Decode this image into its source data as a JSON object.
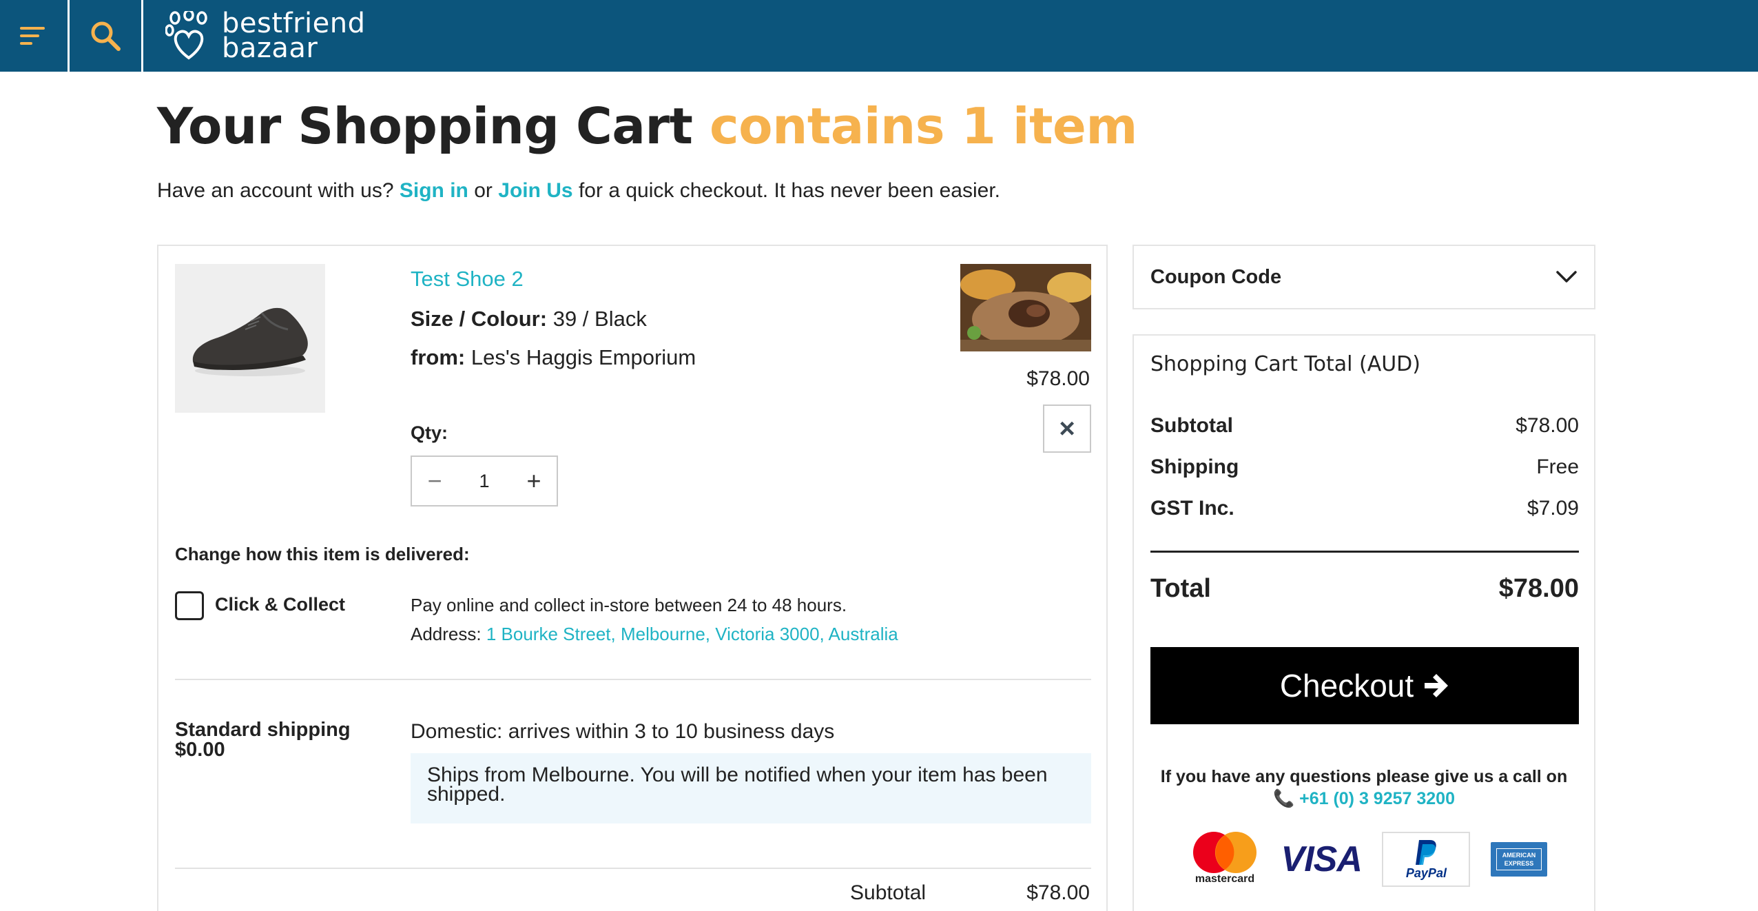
{
  "header": {
    "logo_line1": "bestfriend",
    "logo_line2": "bazaar",
    "colors": {
      "bar": "#0c557c",
      "icon": "#f6b24e"
    }
  },
  "page": {
    "title_main": "Your Shopping Cart",
    "title_count": "contains 1 item",
    "intro_before": "Have an account with us?",
    "sign_in": "Sign in",
    "intro_or": "or",
    "join_us": "Join Us",
    "intro_after": "for a quick checkout. It has never been easier."
  },
  "cart_item": {
    "name": "Test Shoe 2",
    "size_colour_label": "Size / Colour:",
    "size_colour_value": "39 / Black",
    "from_label": "from:",
    "from_value": "Les's Haggis Emporium",
    "price": "$78.00",
    "remove_icon": "×",
    "qty_label": "Qty:",
    "qty_minus": "−",
    "qty_value": "1",
    "qty_plus": "+"
  },
  "delivery": {
    "heading": "Change how this item is delivered:",
    "click_collect_label": "Click & Collect",
    "click_collect_desc": "Pay online and collect in-store between 24 to 48 hours.",
    "address_label": "Address:",
    "address_value": "1 Bourke Street, Melbourne, Victoria 3000, Australia",
    "standard_title": "Standard shipping",
    "standard_price": "$0.00",
    "standard_desc": "Domestic: arrives within 3 to 10 business days",
    "standard_note": "Ships from Melbourne. You will be notified when your item has been shipped.",
    "subtotal_label": "Subtotal",
    "subtotal_value": "$78.00"
  },
  "coupon": {
    "label": "Coupon Code"
  },
  "totals": {
    "title": "Shopping Cart Total (AUD)",
    "rows": [
      {
        "label": "Subtotal",
        "value": "$78.00"
      },
      {
        "label": "Shipping",
        "value": "Free"
      },
      {
        "label": "GST Inc.",
        "value": "$7.09"
      }
    ],
    "total_label": "Total",
    "total_value": "$78.00",
    "checkout_label": "Checkout",
    "help_text": "If you have any questions please give us a call on",
    "phone": "+61 (0) 3 9257 3200",
    "payment_methods": [
      "mastercard",
      "VISA",
      "PayPal",
      "AMERICAN EXPRESS"
    ]
  }
}
